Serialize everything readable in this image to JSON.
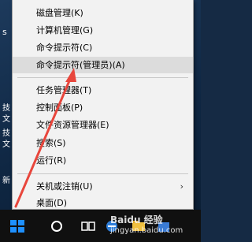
{
  "desktop": {
    "edge_chars": [
      "s",
      "技",
      "文",
      "技",
      "文",
      "新"
    ]
  },
  "context_menu": {
    "items": [
      {
        "label": "磁盘管理(K)"
      },
      {
        "label": "计算机管理(G)"
      },
      {
        "label": "命令提示符(C)"
      },
      {
        "label": "命令提示符(管理员)(A)"
      },
      {
        "label": "任务管理器(T)"
      },
      {
        "label": "控制面板(P)"
      },
      {
        "label": "文件资源管理器(E)"
      },
      {
        "label": "搜索(S)"
      },
      {
        "label": "运行(R)"
      },
      {
        "label": "关机或注销(U)"
      },
      {
        "label": "桌面(D)"
      }
    ],
    "submenu_arrow": "›"
  },
  "taskbar": {
    "icons": [
      "windows-start-icon",
      "cortana-search-icon",
      "task-view-icon",
      "browser-icon",
      "file-explorer-icon",
      "store-icon"
    ]
  },
  "watermark": {
    "line1": "Baidu 经验",
    "line2": "jingyan.baidu.com"
  },
  "colors": {
    "annotation_arrow": "#e8463c",
    "highlight": "#dcdcdc",
    "start_icon": "#1e90ff"
  }
}
